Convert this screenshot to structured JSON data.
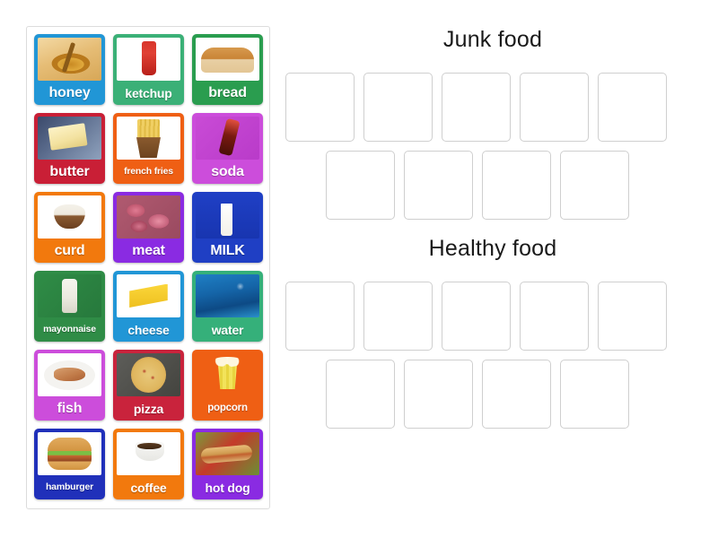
{
  "tray": {
    "tiles": [
      {
        "label": "honey",
        "bg": "#2196d6",
        "art": "art-honey",
        "size": "lbl-lg"
      },
      {
        "label": "ketchup",
        "bg": "#3bb077",
        "art": "art-ketchup",
        "size": "lbl-md"
      },
      {
        "label": "bread",
        "bg": "#2a9d4f",
        "art": "art-bread",
        "size": "lbl-lg"
      },
      {
        "label": "butter",
        "bg": "#c91f36",
        "art": "art-butter",
        "size": "lbl-lg"
      },
      {
        "label": "french fries",
        "bg": "#ef5f14",
        "art": "art-fries",
        "size": "lbl-xs"
      },
      {
        "label": "soda",
        "bg": "#cc4ddb",
        "art": "art-soda",
        "size": "lbl-lg"
      },
      {
        "label": "curd",
        "bg": "#f2790d",
        "art": "art-curd",
        "size": "lbl-lg"
      },
      {
        "label": "meat",
        "bg": "#8a2be2",
        "art": "art-meat",
        "size": "lbl-lg"
      },
      {
        "label": "MILK",
        "bg": "#1f3fc4",
        "art": "art-milk",
        "size": "lbl-lg"
      },
      {
        "label": "mayonnaise",
        "bg": "#2f8c46",
        "art": "art-mayo",
        "size": "lbl-xs"
      },
      {
        "label": "cheese",
        "bg": "#2196d6",
        "art": "art-cheese",
        "size": "lbl-md"
      },
      {
        "label": "water",
        "bg": "#35b07a",
        "art": "art-water",
        "size": "lbl-md"
      },
      {
        "label": "fish",
        "bg": "#cc4ddb",
        "art": "art-fish",
        "size": "lbl-lg"
      },
      {
        "label": "pizza",
        "bg": "#c9233c",
        "art": "art-pizza",
        "size": "lbl-md"
      },
      {
        "label": "popcorn",
        "bg": "#ef5f14",
        "art": "art-popcorn",
        "size": "lbl-sm"
      },
      {
        "label": "hamburger",
        "bg": "#2030ba",
        "art": "art-burger",
        "size": "lbl-xs"
      },
      {
        "label": "coffee",
        "bg": "#f2790d",
        "art": "art-coffee",
        "size": "lbl-md"
      },
      {
        "label": "hot dog",
        "bg": "#8a2be2",
        "art": "art-hotdog",
        "size": "lbl-md"
      }
    ]
  },
  "categories": [
    {
      "title": "Junk food",
      "rows": [
        {
          "indent": false,
          "slots": 5
        },
        {
          "indent": true,
          "slots": 4
        }
      ]
    },
    {
      "title": "Healthy food",
      "rows": [
        {
          "indent": false,
          "slots": 5
        },
        {
          "indent": true,
          "slots": 4
        }
      ]
    }
  ],
  "colors": {
    "page_background": "#ffffff",
    "tray_border": "#dcdcdc",
    "slot_border": "#cfcfcf",
    "title_text": "#1a1a1a",
    "tile_label_text": "#ffffff"
  }
}
